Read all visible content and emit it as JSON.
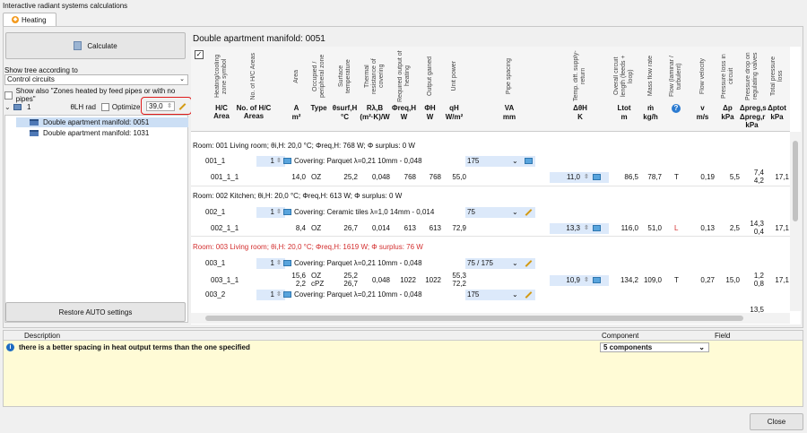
{
  "window_title": "Interactive radiant systems calculations",
  "tab_heating": "Heating",
  "left": {
    "calculate_label": "Calculate",
    "show_tree_label": "Show tree according to",
    "tree_select_value": "Control circuits",
    "show_also_label": "Show also \"Zones heated by feed pipes or with no pipes\"",
    "tree_node_label": "1",
    "theta_label": "θLH rad",
    "optimize_label": "Optimize",
    "optimize_value": "39,0",
    "tree_items": [
      "Double apartment manifold: 0051",
      "Double apartment manifold: 1031"
    ],
    "restore_label": "Restore AUTO settings"
  },
  "grid": {
    "title": "Double apartment manifold: 0051",
    "headers": [
      {
        "vertical": "Heating/cooling zone symbol",
        "symbol": "H/C Area",
        "unit": ""
      },
      {
        "vertical": "No. of H/C Areas",
        "symbol": "No. of H/C Areas",
        "unit": ""
      },
      {
        "vertical": "Area",
        "symbol": "A",
        "unit": "m²"
      },
      {
        "vertical": "Occupied / peripheral zone",
        "symbol": "Type",
        "unit": ""
      },
      {
        "vertical": "Surface temperature",
        "symbol": "θsurf,H",
        "unit": "°C"
      },
      {
        "vertical": "Thermal resistance of covering",
        "symbol": "Rλ,B",
        "unit": "(m²·K)/W"
      },
      {
        "vertical": "Required output of heating",
        "symbol": "Φreq,H",
        "unit": "W"
      },
      {
        "vertical": "Output gained",
        "symbol": "ΦH",
        "unit": "W"
      },
      {
        "vertical": "Unit power",
        "symbol": "qH",
        "unit": "W/m²"
      },
      {
        "vertical": "Pipe spacing",
        "symbol": "VA",
        "unit": "mm"
      },
      {
        "vertical": "Temp. diff. supply-return",
        "symbol": "ΔθH",
        "unit": "K"
      },
      {
        "vertical": "Overall circuit length (feeds + loop)",
        "symbol": "Ltot",
        "unit": "m"
      },
      {
        "vertical": "Mass flow rate",
        "symbol": "ṁ",
        "unit": "kg/h"
      },
      {
        "vertical": "Flow (laminar / turbulent)",
        "symbol": "?",
        "unit": ""
      },
      {
        "vertical": "Flow velocity",
        "symbol": "v",
        "unit": "m/s"
      },
      {
        "vertical": "Pressure loss in circuit",
        "symbol": "Δp",
        "unit": "kPa"
      },
      {
        "vertical": "Pressure drop on regulating valves",
        "symbol": "Δpreg,s",
        "unit": "Δpreg,r kPa"
      },
      {
        "vertical": "Total pressure loss",
        "symbol": "Δptot",
        "unit": "kPa"
      }
    ],
    "rooms": [
      {
        "title": "Room: 001 Living room; θi,H: 20,0 °C; Φreq,H: 768 W; Φ surplus: 0 W",
        "warn": false
      },
      {
        "title": "Room: 002 Kitchen; θi,H: 20,0 °C; Φreq,H: 613 W; Φ surplus: 0 W",
        "warn": false
      },
      {
        "title": "Room: 003 Living room; θi,H: 20,0 °C; Φreq,H: 1619 W; Φ surplus: 76 W",
        "warn": true
      }
    ],
    "rows": {
      "r001": {
        "name": "001_1",
        "count": "1",
        "covering": "Covering: Parquet λ=0,21 10mm - 0,048",
        "spacing": "175"
      },
      "r001_1": {
        "name": "001_1_1",
        "area": "14,0",
        "type": "OZ",
        "temp": "25,2",
        "res": "0,048",
        "req": "768",
        "out": "768",
        "unit": "55,0",
        "dtheta": "11,0",
        "len": "86,5",
        "mass": "78,7",
        "flow": "T",
        "vel": "0,19",
        "dp": "5,5",
        "reg_s": "7,4",
        "reg_r": "4,2",
        "tot": "17,1"
      },
      "r002": {
        "name": "002_1",
        "count": "1",
        "covering": "Covering: Ceramic tiles λ=1,0 14mm - 0,014",
        "spacing": "75"
      },
      "r002_1": {
        "name": "002_1_1",
        "area": "8,4",
        "type": "OZ",
        "temp": "26,7",
        "res": "0,014",
        "req": "613",
        "out": "613",
        "unit": "72,9",
        "dtheta": "13,3",
        "len": "116,0",
        "mass": "51,0",
        "flow": "L",
        "vel": "0,13",
        "dp": "2,5",
        "reg_s": "14,3",
        "reg_r": "0,4",
        "tot": "17,1"
      },
      "r003": {
        "name": "003_1",
        "count": "1",
        "covering": "Covering: Parquet λ=0,21 10mm - 0,048",
        "spacing": "75 / 175"
      },
      "r003_1": {
        "name": "003_1_1",
        "area1": "15,6",
        "area2": "2,2",
        "type1": "OZ",
        "type2": "cPZ",
        "temp1": "25,2",
        "temp2": "26,7",
        "res": "0,048",
        "req": "1022",
        "out": "1022",
        "unit1": "55,3",
        "unit2": "72,2",
        "dtheta": "10,9",
        "len": "134,2",
        "mass": "109,0",
        "flow": "T",
        "vel": "0,27",
        "dp": "15,0",
        "reg_s": "1,2",
        "reg_r": "0,8",
        "tot": "17,1"
      },
      "r003b": {
        "name": "003_2",
        "count": "1",
        "covering": "Covering: Parquet λ=0,21 10mm - 0,048",
        "spacing": "175",
        "reg_s": "13,5"
      }
    }
  },
  "messages": {
    "col_description": "Description",
    "col_component": "Component",
    "col_field": "Field",
    "message": "there is a better spacing in heat output terms than the one specified",
    "component_value": "5 components"
  },
  "close_label": "Close",
  "colors": {
    "warning_red": "#d32f2f",
    "highlight_frame": "#e01c1c",
    "message_bg": "#fffbd6",
    "selected_row": "#ccdff5"
  }
}
